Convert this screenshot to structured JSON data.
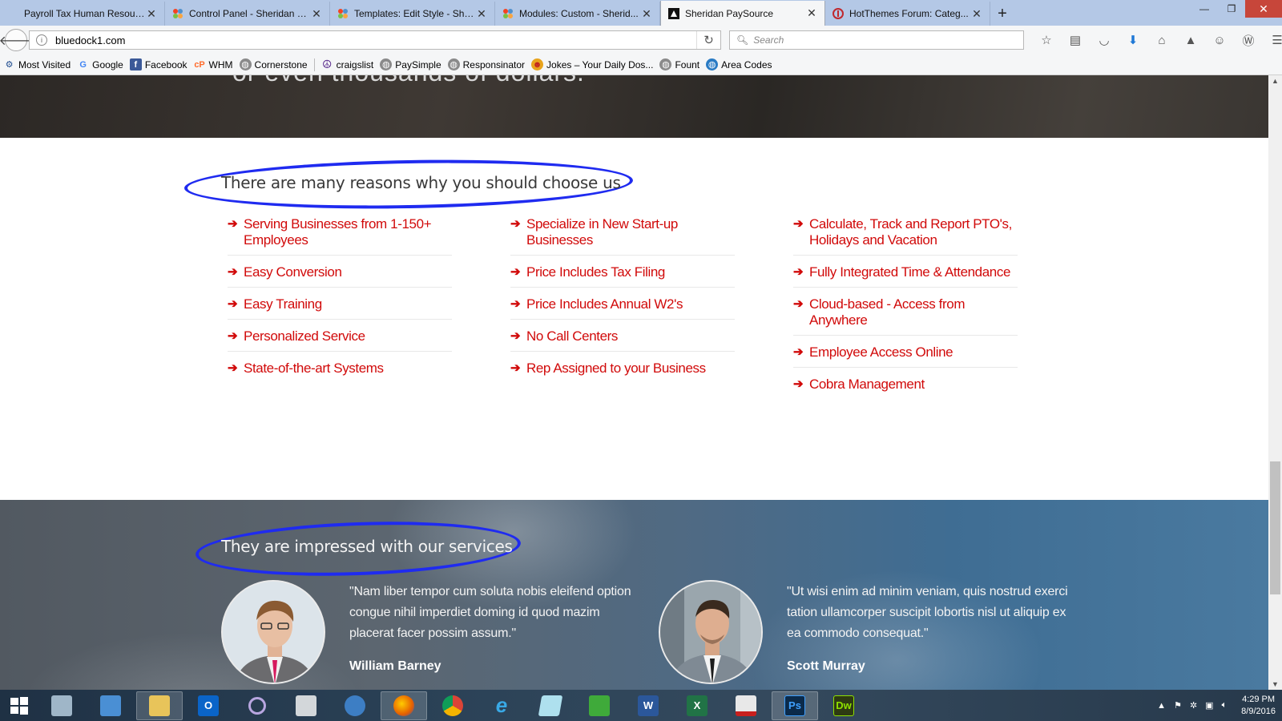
{
  "browser": {
    "tabs": [
      {
        "title": "Payroll Tax Human Resources",
        "favicon": "blank-page-icon",
        "active": false
      },
      {
        "title": "Control Panel - Sheridan P...",
        "favicon": "joomla-icon",
        "active": false
      },
      {
        "title": "Templates: Edit Style - She...",
        "favicon": "joomla-icon",
        "active": false
      },
      {
        "title": "Modules: Custom - Sherid...",
        "favicon": "joomla-icon",
        "active": false
      },
      {
        "title": "Sheridan PaySource",
        "favicon": "sheridan-icon",
        "active": true
      },
      {
        "title": "HotThemes Forum: Categ...",
        "favicon": "hotthemes-icon",
        "active": false
      }
    ],
    "url": "bluedock1.com",
    "search_placeholder": "Search",
    "bookmarks": [
      {
        "label": "Most Visited",
        "icon": "gear-icon"
      },
      {
        "label": "Google",
        "icon": "google-icon"
      },
      {
        "label": "Facebook",
        "icon": "facebook-icon"
      },
      {
        "label": "WHM",
        "icon": "cpanel-icon"
      },
      {
        "label": "Cornerstone",
        "icon": "globe-icon"
      },
      {
        "label": "craigslist",
        "icon": "peace-icon"
      },
      {
        "label": "PaySimple",
        "icon": "globe-icon"
      },
      {
        "label": "Responsinator",
        "icon": "globe-icon"
      },
      {
        "label": "Jokes – Your Daily Dos...",
        "icon": "jokes-icon"
      },
      {
        "label": "Fount",
        "icon": "globe-icon"
      },
      {
        "label": "Area Codes",
        "icon": "earth-icon"
      }
    ]
  },
  "hero": {
    "text": "or even thousands of dollars."
  },
  "reasons": {
    "title": "There are many reasons why you should choose us",
    "columns": [
      [
        "Serving Businesses from 1-150+ Employees",
        "Easy Conversion",
        "Easy Training",
        "Personalized Service",
        "State-of-the-art Systems"
      ],
      [
        "Specialize in New Start-up Businesses",
        "Price Includes Tax Filing",
        "Price Includes Annual W2's",
        "No Call Centers",
        "Rep Assigned to your Business"
      ],
      [
        "Calculate, Track and Report PTO's, Holidays and Vacation",
        "Fully Integrated Time & Attendance",
        "Cloud-based - Access from Anywhere",
        "Employee Access Online",
        "Cobra Management"
      ]
    ]
  },
  "testimonials": {
    "title": "They are impressed with our services",
    "items": [
      {
        "quote": "\"Nam liber tempor cum soluta nobis eleifend option congue nihil imperdiet doming id quod mazim placerat facer possim assum.\"",
        "name": "William Barney"
      },
      {
        "quote": "\"Ut wisi enim ad minim veniam, quis nostrud exerci tation ullamcorper suscipit lobortis nisl ut aliquip ex ea commodo consequat.\"",
        "name": "Scott Murray"
      }
    ]
  },
  "taskbar": {
    "apps": [
      {
        "name": "server-manager-icon",
        "label": ""
      },
      {
        "name": "remote-desktop-icon",
        "label": ""
      },
      {
        "name": "file-explorer-icon",
        "label": ""
      },
      {
        "name": "outlook-icon",
        "label": "O"
      },
      {
        "name": "cortana-icon",
        "label": ""
      },
      {
        "name": "calculator-icon",
        "label": ""
      },
      {
        "name": "network-globe-icon",
        "label": ""
      },
      {
        "name": "firefox-icon",
        "label": ""
      },
      {
        "name": "chrome-icon",
        "label": ""
      },
      {
        "name": "internet-explorer-icon",
        "label": "e"
      },
      {
        "name": "notes-icon",
        "label": ""
      },
      {
        "name": "solitaire-icon",
        "label": ""
      },
      {
        "name": "word-icon",
        "label": "W"
      },
      {
        "name": "excel-icon",
        "label": "X"
      },
      {
        "name": "acrobat-icon",
        "label": ""
      },
      {
        "name": "photoshop-icon",
        "label": "Ps"
      },
      {
        "name": "dreamweaver-icon",
        "label": "Dw"
      }
    ],
    "time": "4:29 PM",
    "date": "8/9/2016"
  },
  "colors": {
    "accent_red": "#d10a0a",
    "annotation_blue": "#1f2bf0"
  }
}
